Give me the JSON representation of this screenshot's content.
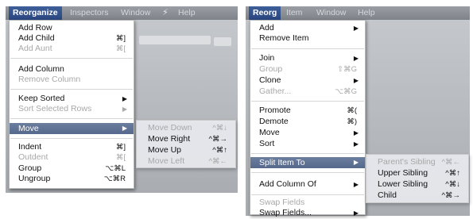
{
  "left": {
    "menubar": {
      "items": [
        {
          "label": "Reorganize",
          "selected": true
        },
        {
          "label": "Inspectors"
        },
        {
          "label": "Window"
        },
        {
          "label": "⚡",
          "icon": "script-bolt-icon"
        },
        {
          "label": "Help"
        }
      ]
    },
    "menu": [
      {
        "label": "Add Row",
        "shortcut": ""
      },
      {
        "label": "Add Child",
        "shortcut": "⌘]"
      },
      {
        "label": "Add Aunt",
        "shortcut": "⌘[",
        "disabled": true
      },
      {
        "label": "Add Column",
        "shortcut": ""
      },
      {
        "label": "Remove Column",
        "disabled": true
      },
      {
        "label": "Keep Sorted",
        "submenu": true
      },
      {
        "label": "Sort Selected Rows",
        "submenu": true,
        "disabled": true
      },
      {
        "label": "Move",
        "submenu": true,
        "highlighted": true
      },
      {
        "label": "Indent",
        "shortcut": "⌘]"
      },
      {
        "label": "Outdent",
        "shortcut": "⌘[",
        "disabled": true
      },
      {
        "label": "Group",
        "shortcut": "⌥⌘L"
      },
      {
        "label": "Ungroup",
        "shortcut": "⌥⌘R"
      }
    ],
    "submenu": [
      {
        "label": "Move Down",
        "shortcut": "^⌘↓",
        "disabled": true
      },
      {
        "label": "Move Right",
        "shortcut": "^⌘→"
      },
      {
        "label": "Move Up",
        "shortcut": "^⌘↑"
      },
      {
        "label": "Move Left",
        "shortcut": "^⌘←",
        "disabled": true
      }
    ]
  },
  "right": {
    "menubar": {
      "items": [
        {
          "label": "Reorg",
          "selected": true
        },
        {
          "label": "Item"
        },
        {
          "label": "Window"
        },
        {
          "label": "Help"
        }
      ]
    },
    "menu": [
      {
        "label": "Add",
        "submenu": true
      },
      {
        "label": "Remove Item"
      },
      {
        "label": "Join",
        "submenu": true
      },
      {
        "label": "Group",
        "shortcut": "⇧⌘G",
        "disabled": true
      },
      {
        "label": "Clone",
        "submenu": true
      },
      {
        "label": "Gather...",
        "shortcut": "⌥⌘G",
        "disabled": true
      },
      {
        "label": "Promote",
        "shortcut": "⌘("
      },
      {
        "label": "Demote",
        "shortcut": "⌘)"
      },
      {
        "label": "Move",
        "submenu": true
      },
      {
        "label": "Sort",
        "submenu": true
      },
      {
        "label": "Split Item To",
        "submenu": true,
        "highlighted": true
      },
      {
        "label": "Add Column Of",
        "submenu": true
      },
      {
        "label": "Swap Fields",
        "disabled": true
      },
      {
        "label": "Swap Fields...",
        "submenu": true
      }
    ],
    "submenu": [
      {
        "label": "Parent's Sibling",
        "shortcut": "^⌘←",
        "disabled": true
      },
      {
        "label": "Upper Sibling",
        "shortcut": "^⌘↑"
      },
      {
        "label": "Lower Sibling",
        "shortcut": "^⌘↓"
      },
      {
        "label": "Child",
        "shortcut": "^⌘→"
      }
    ]
  },
  "arrow_glyph": "▶"
}
